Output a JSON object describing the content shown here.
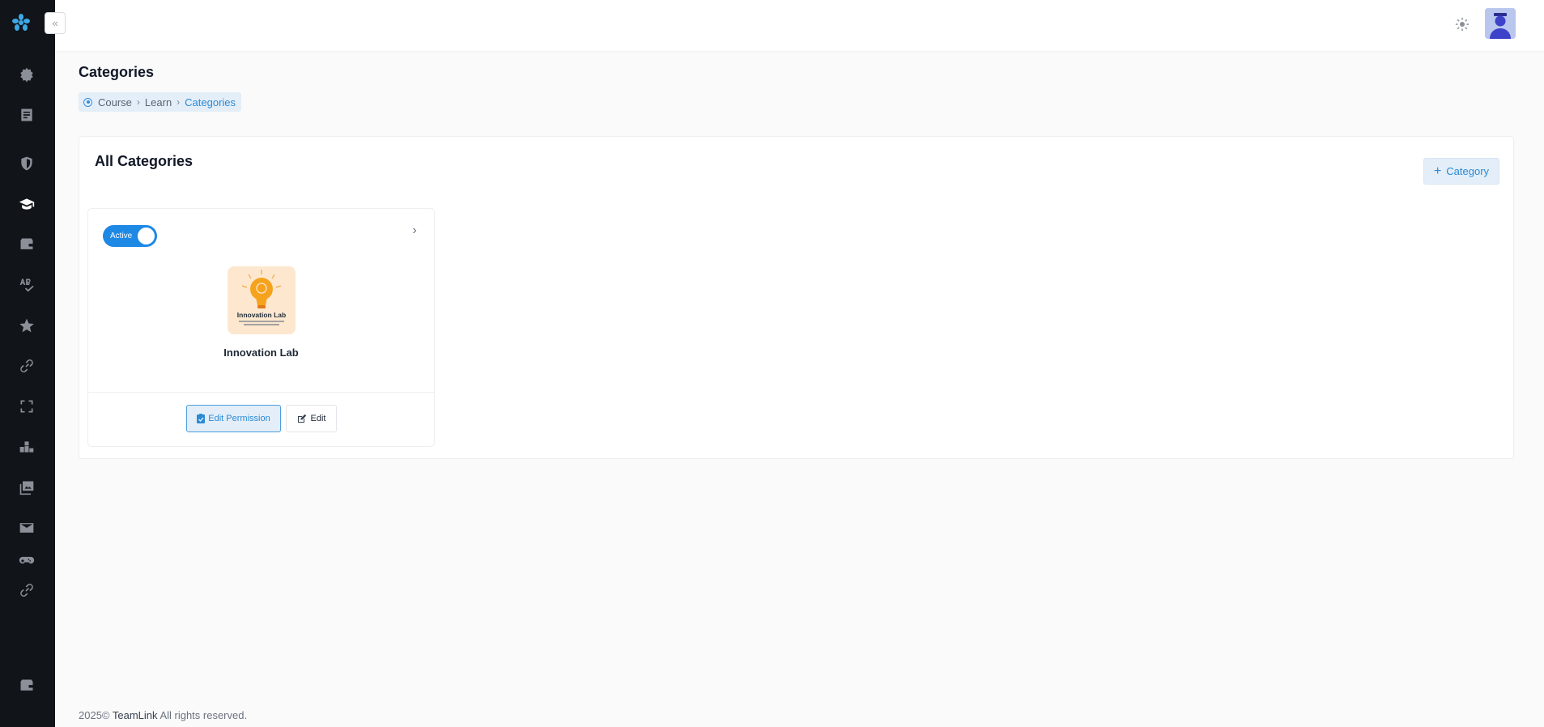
{
  "page": {
    "title": "Categories"
  },
  "breadcrumb": {
    "items": [
      "Course",
      "Learn",
      "Categories"
    ]
  },
  "section": {
    "title": "All Categories",
    "add_button_label": "Category"
  },
  "categories": [
    {
      "status_label": "Active",
      "status_on": true,
      "name": "Innovation Lab",
      "image_text": "Innovation Lab",
      "edit_permission_label": "Edit Permission",
      "edit_label": "Edit"
    }
  ],
  "footer": {
    "year": "2025©",
    "brand": "TeamLink",
    "rights": "All rights reserved."
  },
  "colors": {
    "accent": "#1e88e5",
    "sidebar_bg": "#111418",
    "page_bg": "#fafafa"
  },
  "sidebar": {
    "icons": [
      "settings-icon",
      "book-icon",
      "shield-icon",
      "graduation-cap-icon",
      "wallet-icon",
      "spellcheck-icon",
      "star-icon",
      "link-icon",
      "expand-icon",
      "chart-icon",
      "gallery-icon",
      "mail-icon",
      "gamepad-icon",
      "link-icon",
      "wallet-icon"
    ]
  }
}
